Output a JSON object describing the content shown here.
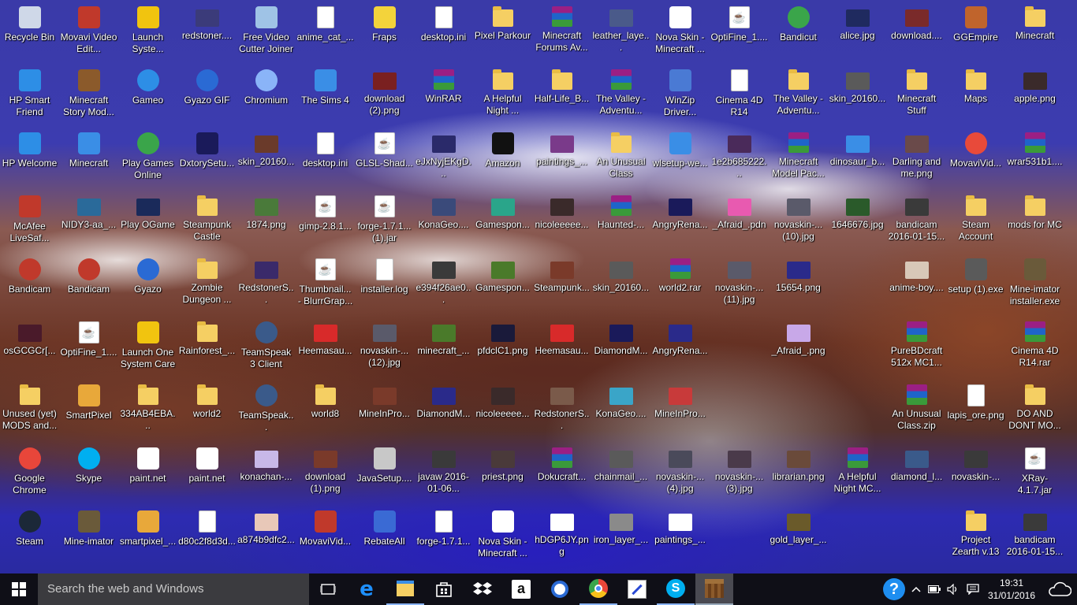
{
  "desktop": {
    "icons": [
      {
        "label": "Recycle Bin",
        "kind": "app",
        "color": "#cfd8e8"
      },
      {
        "label": "Movavi Video Edit...",
        "kind": "app",
        "color": "#c0392b"
      },
      {
        "label": "Launch Syste...",
        "kind": "app",
        "color": "#f1c40f"
      },
      {
        "label": "redstoner....",
        "kind": "img",
        "color": "#3b3b7a"
      },
      {
        "label": "Free Video Cutter Joiner",
        "kind": "app",
        "color": "#9fc3e6"
      },
      {
        "label": "anime_cat_...",
        "kind": "doc",
        "color": "#ffffff"
      },
      {
        "label": "Fraps",
        "kind": "app",
        "color": "#f3d33b"
      },
      {
        "label": "desktop.ini",
        "kind": "doc",
        "color": "#6a6fd1"
      },
      {
        "label": "Pixel Parkour",
        "kind": "folder",
        "color": "#f5cf63"
      },
      {
        "label": "Minecraft Forums Av...",
        "kind": "rar",
        "color": "#9b1f84"
      },
      {
        "label": "leather_laye...",
        "kind": "img",
        "color": "#4a5a8a"
      },
      {
        "label": "Nova Skin - Minecraft ...",
        "kind": "app",
        "color": "#ffffff"
      },
      {
        "label": "OptiFine_1....",
        "kind": "java",
        "color": "#ffffff"
      },
      {
        "label": "Bandicut",
        "kind": "round",
        "color": "#3aa54a"
      },
      {
        "label": "alice.jpg",
        "kind": "img",
        "color": "#1f2a5f"
      },
      {
        "label": "download....",
        "kind": "img",
        "color": "#7a2a2a"
      },
      {
        "label": "GGEmpire",
        "kind": "app",
        "color": "#c0642c"
      },
      {
        "label": "Minecraft",
        "kind": "folder",
        "color": "#f5cf63"
      },
      {
        "label": "HP Smart Friend",
        "kind": "app",
        "color": "#2d8ee6"
      },
      {
        "label": "Minecraft Story Mod...",
        "kind": "app",
        "color": "#8b5a2b"
      },
      {
        "label": "Gameo",
        "kind": "round",
        "color": "#2d8ee6"
      },
      {
        "label": "Gyazo GIF",
        "kind": "round",
        "color": "#2a6ad4"
      },
      {
        "label": "Chromium",
        "kind": "round",
        "color": "#8ab4f8"
      },
      {
        "label": "The Sims 4",
        "kind": "app",
        "color": "#3a8ee6"
      },
      {
        "label": "download (2).png",
        "kind": "img",
        "color": "#7a2020"
      },
      {
        "label": "WinRAR",
        "kind": "rar",
        "color": "#9b1f84"
      },
      {
        "label": "A Helpful Night ...",
        "kind": "folder",
        "color": "#f5cf63"
      },
      {
        "label": "Half-Life_B...",
        "kind": "folder",
        "color": "#f5cf63"
      },
      {
        "label": "The Valley -Adventu...",
        "kind": "rar",
        "color": "#9b1f84"
      },
      {
        "label": "WinZip Driver...",
        "kind": "app",
        "color": "#4a7ad4"
      },
      {
        "label": "Cinema 4D R14",
        "kind": "doc",
        "color": "#ffffff"
      },
      {
        "label": "The Valley -Adventu...",
        "kind": "folder",
        "color": "#f5cf63"
      },
      {
        "label": "skin_20160...",
        "kind": "img",
        "color": "#5a5a5a"
      },
      {
        "label": "Minecraft Stuff",
        "kind": "folder",
        "color": "#f5cf63"
      },
      {
        "label": "Maps",
        "kind": "folder",
        "color": "#f5cf63"
      },
      {
        "label": "apple.png",
        "kind": "img",
        "color": "#3a2a2a"
      },
      {
        "label": "HP Welcome",
        "kind": "app",
        "color": "#2d8ee6"
      },
      {
        "label": "Minecraft",
        "kind": "app",
        "color": "#3a8ee6"
      },
      {
        "label": "Play Games Online",
        "kind": "round",
        "color": "#3aa54a"
      },
      {
        "label": "DxtorySetu...",
        "kind": "app",
        "color": "#1a1a5a"
      },
      {
        "label": "skin_20160...",
        "kind": "img",
        "color": "#6a3a2a"
      },
      {
        "label": "desktop.ini",
        "kind": "doc",
        "color": "#6a6fd1"
      },
      {
        "label": "GLSL-Shad...",
        "kind": "java",
        "color": "#ffffff"
      },
      {
        "label": "eJxNyjEKgD...",
        "kind": "img",
        "color": "#2a2a6a"
      },
      {
        "label": "Amazon",
        "kind": "app",
        "color": "#111111"
      },
      {
        "label": "paintings_...",
        "kind": "img",
        "color": "#7a3a8a"
      },
      {
        "label": "An Unusual Class",
        "kind": "folder",
        "color": "#f5cf63"
      },
      {
        "label": "wlsetup-we...",
        "kind": "app",
        "color": "#3a8ee6"
      },
      {
        "label": "1e2b685222...",
        "kind": "img",
        "color": "#4a2a5a"
      },
      {
        "label": "Minecraft Model Pac...",
        "kind": "rar",
        "color": "#9b1f84"
      },
      {
        "label": "dinosaur_b...",
        "kind": "img",
        "color": "#3a8ee6"
      },
      {
        "label": "Darling and me.png",
        "kind": "img",
        "color": "#6a4a4a"
      },
      {
        "label": "MovaviVid...",
        "kind": "round",
        "color": "#e84a3a"
      },
      {
        "label": "wrar531b1....",
        "kind": "rar",
        "color": "#9b1f84"
      },
      {
        "label": "McAfee LiveSaf...",
        "kind": "app",
        "color": "#c0392b"
      },
      {
        "label": "NIDY3-aa_...",
        "kind": "img",
        "color": "#2a6a9a"
      },
      {
        "label": "Play OGame",
        "kind": "img",
        "color": "#1a2a5a"
      },
      {
        "label": "Steampunk Castle",
        "kind": "folder",
        "color": "#f5cf63"
      },
      {
        "label": "1874.png",
        "kind": "img",
        "color": "#4a7a3a"
      },
      {
        "label": "gimp-2.8.1...",
        "kind": "java",
        "color": "#ffffff"
      },
      {
        "label": "forge-1.7.1... (1).jar",
        "kind": "java",
        "color": "#ffffff"
      },
      {
        "label": "KonaGeo....",
        "kind": "img",
        "color": "#3a4a7a"
      },
      {
        "label": "Gamespon...",
        "kind": "img",
        "color": "#2aa58a"
      },
      {
        "label": "nicoleeeee...",
        "kind": "img",
        "color": "#3a2a2a"
      },
      {
        "label": "Haunted-...",
        "kind": "rar",
        "color": "#9b1f84"
      },
      {
        "label": "AngryRena...",
        "kind": "img",
        "color": "#1a1a5a"
      },
      {
        "label": "_Afraid_.pdn",
        "kind": "img",
        "color": "#e85ab0"
      },
      {
        "label": "novaskin-... (10).jpg",
        "kind": "img",
        "color": "#5a5a6a"
      },
      {
        "label": "1646676.jpg",
        "kind": "img",
        "color": "#2a5a2a"
      },
      {
        "label": "bandicam 2016-01-15...",
        "kind": "img",
        "color": "#3a3a3a"
      },
      {
        "label": "Steam Account",
        "kind": "folder",
        "color": "#f5cf63"
      },
      {
        "label": "mods for MC",
        "kind": "folder",
        "color": "#f5cf63"
      },
      {
        "label": "Bandicam",
        "kind": "round",
        "color": "#c0392b"
      },
      {
        "label": "Bandicam",
        "kind": "round",
        "color": "#c0392b"
      },
      {
        "label": "Gyazo",
        "kind": "round",
        "color": "#2a6ad4"
      },
      {
        "label": "Zombie Dungeon ...",
        "kind": "folder",
        "color": "#f5cf63"
      },
      {
        "label": "RedstonerS...",
        "kind": "img",
        "color": "#3a2a6a"
      },
      {
        "label": "Thumbnail... - BlurrGrap...",
        "kind": "java",
        "color": "#ffffff"
      },
      {
        "label": "installer.log",
        "kind": "doc",
        "color": "#ffffff"
      },
      {
        "label": "e394f26ae0...",
        "kind": "img",
        "color": "#3a3a3a"
      },
      {
        "label": "Gamespon...",
        "kind": "img",
        "color": "#4a7a2a"
      },
      {
        "label": "Steampunk...",
        "kind": "img",
        "color": "#7a3a2a"
      },
      {
        "label": "skin_20160...",
        "kind": "img",
        "color": "#5a5a5a"
      },
      {
        "label": "world2.rar",
        "kind": "rar",
        "color": "#9b1f84"
      },
      {
        "label": "novaskin-... (11).jpg",
        "kind": "img",
        "color": "#5a5a6a"
      },
      {
        "label": "15654.png",
        "kind": "img",
        "color": "#2a2a8a"
      },
      {
        "label": "anime-boy....",
        "kind": "img",
        "color": "#d8c8b8"
      },
      {
        "label": "setup (1).exe",
        "kind": "app",
        "color": "#5a5a5a"
      },
      {
        "label": "Mine-imator installer.exe",
        "kind": "app",
        "color": "#6a5a3a"
      },
      {
        "label": "osGCGCr[...",
        "kind": "img",
        "color": "#4a1a2a"
      },
      {
        "label": "OptiFine_1....",
        "kind": "java",
        "color": "#ffffff"
      },
      {
        "label": "Launch One System Care",
        "kind": "app",
        "color": "#f1c40f"
      },
      {
        "label": "Rainforest_...",
        "kind": "folder",
        "color": "#f5cf63"
      },
      {
        "label": "TeamSpeak 3 Client",
        "kind": "round",
        "color": "#3a5a8a"
      },
      {
        "label": "Heemasau...",
        "kind": "img",
        "color": "#d82a2a"
      },
      {
        "label": "novaskin-... (12).jpg",
        "kind": "img",
        "color": "#5a5a6a"
      },
      {
        "label": "minecraft_...",
        "kind": "img",
        "color": "#4a7a2a"
      },
      {
        "label": "pfdclC1.png",
        "kind": "img",
        "color": "#1a1a3a"
      },
      {
        "label": "Heemasau...",
        "kind": "img",
        "color": "#d82a2a"
      },
      {
        "label": "DiamondM...",
        "kind": "img",
        "color": "#1a1a5a"
      },
      {
        "label": "AngryRena...",
        "kind": "img",
        "color": "#2a2a8a"
      },
      {
        "label": "_Afraid_.png",
        "kind": "img",
        "color": "#c8a8e8"
      },
      {
        "label": "PureBDcraft 512x MC1...",
        "kind": "rar",
        "color": "#9b1f84"
      },
      {
        "label": "Cinema 4D R14.rar",
        "kind": "rar",
        "color": "#9b1f84"
      },
      {
        "label": "Unused (yet) MODS and...",
        "kind": "folder",
        "color": "#f5cf63"
      },
      {
        "label": "SmartPixel",
        "kind": "app",
        "color": "#e8a83a"
      },
      {
        "label": "334AB4EBA...",
        "kind": "folder",
        "color": "#f5cf63"
      },
      {
        "label": "world2",
        "kind": "folder",
        "color": "#f5cf63"
      },
      {
        "label": "TeamSpeak...",
        "kind": "round",
        "color": "#3a5a8a"
      },
      {
        "label": "world8",
        "kind": "folder",
        "color": "#f5cf63"
      },
      {
        "label": "MineInPro...",
        "kind": "img",
        "color": "#7a3a2a"
      },
      {
        "label": "DiamondM...",
        "kind": "img",
        "color": "#2a2a8a"
      },
      {
        "label": "nicoleeeee...",
        "kind": "img",
        "color": "#3a2a2a"
      },
      {
        "label": "RedstonerS...",
        "kind": "img",
        "color": "#7a5a4a"
      },
      {
        "label": "KonaGeo....",
        "kind": "img",
        "color": "#3aa5c8"
      },
      {
        "label": "MineInPro...",
        "kind": "img",
        "color": "#c83a3a"
      },
      {
        "label": "An Unusual Class.zip",
        "kind": "rar",
        "color": "#9b1f84"
      },
      {
        "label": "lapis_ore.png",
        "kind": "doc",
        "color": "#ffffff"
      },
      {
        "label": "DO AND DONT MO...",
        "kind": "folder",
        "color": "#f5cf63"
      },
      {
        "label": "Google Chrome",
        "kind": "round",
        "color": "#e8463a"
      },
      {
        "label": "Skype",
        "kind": "round",
        "color": "#00aff0"
      },
      {
        "label": "paint.net",
        "kind": "app",
        "color": "#ffffff"
      },
      {
        "label": "paint.net",
        "kind": "app",
        "color": "#ffffff"
      },
      {
        "label": "konachan-...",
        "kind": "img",
        "color": "#c8b8e8"
      },
      {
        "label": "download (1).png",
        "kind": "img",
        "color": "#7a3a2a"
      },
      {
        "label": "JavaSetup....",
        "kind": "app",
        "color": "#c8c8c8"
      },
      {
        "label": "javaw 2016-01-06...",
        "kind": "img",
        "color": "#3a3a3a"
      },
      {
        "label": "priest.png",
        "kind": "img",
        "color": "#4a3a3a"
      },
      {
        "label": "Dokucraft...",
        "kind": "rar",
        "color": "#9b1f84"
      },
      {
        "label": "chainmail_...",
        "kind": "img",
        "color": "#5a5a5a"
      },
      {
        "label": "novaskin-... (4).jpg",
        "kind": "img",
        "color": "#4a4a5a"
      },
      {
        "label": "novaskin-... (3).jpg",
        "kind": "img",
        "color": "#4a3a4a"
      },
      {
        "label": "librarian.png",
        "kind": "img",
        "color": "#6a4a3a"
      },
      {
        "label": "A Helpful Night MC...",
        "kind": "rar",
        "color": "#9b1f84"
      },
      {
        "label": "diamond_l...",
        "kind": "img",
        "color": "#3a5a8a"
      },
      {
        "label": "novaskin-...",
        "kind": "img",
        "color": "#3a3a3a"
      },
      {
        "label": "XRay-4.1.7.jar",
        "kind": "java",
        "color": "#ffffff"
      },
      {
        "label": "Steam",
        "kind": "round",
        "color": "#1b2838"
      },
      {
        "label": "Mine-imator",
        "kind": "app",
        "color": "#6a5a3a"
      },
      {
        "label": "smartpixel_...",
        "kind": "app",
        "color": "#e8a83a"
      },
      {
        "label": "d80c2f8d3d...",
        "kind": "doc",
        "color": "#ffffff"
      },
      {
        "label": "a874b9dfc2...",
        "kind": "img",
        "color": "#e8c8b8"
      },
      {
        "label": "MovaviVid...",
        "kind": "app",
        "color": "#c0392b"
      },
      {
        "label": "RebateAll",
        "kind": "app",
        "color": "#3a6ad4"
      },
      {
        "label": "forge-1.7.1...",
        "kind": "doc",
        "color": "#ffffff"
      },
      {
        "label": "Nova Skin - Minecraft ...",
        "kind": "app",
        "color": "#ffffff"
      },
      {
        "label": "hDGP6JY.png",
        "kind": "img",
        "color": "#ffffff"
      },
      {
        "label": "iron_layer_...",
        "kind": "img",
        "color": "#8a8a8a"
      },
      {
        "label": "paintings_...",
        "kind": "img",
        "color": "#ffffff"
      },
      {
        "label": "gold_layer_...",
        "kind": "img",
        "color": "#6a5a2a"
      },
      {
        "label": "Project Zearth v.13",
        "kind": "folder",
        "color": "#f5cf63"
      },
      {
        "label": "bandicam 2016-01-15...",
        "kind": "img",
        "color": "#3a3a3a"
      }
    ]
  },
  "taskbar": {
    "search_placeholder": "Search the web and Windows",
    "pinned": [
      {
        "name": "task-view",
        "icon": "task-view-icon"
      },
      {
        "name": "edge",
        "icon": "edge-icon"
      },
      {
        "name": "file-explorer",
        "icon": "folder-icon"
      },
      {
        "name": "store",
        "icon": "store-icon"
      },
      {
        "name": "dropbox",
        "icon": "dropbox-icon"
      },
      {
        "name": "amazon",
        "icon": "amazon-icon"
      },
      {
        "name": "gyazo",
        "icon": "gyazo-icon"
      },
      {
        "name": "chrome",
        "icon": "chrome-icon"
      },
      {
        "name": "paint-net",
        "icon": "paint-icon"
      },
      {
        "name": "skype",
        "icon": "skype-icon"
      },
      {
        "name": "minecraft",
        "icon": "crafting-table-icon"
      }
    ],
    "tray": {
      "help_icon": "question-icon",
      "time": "19:31",
      "date": "31/01/2016"
    }
  }
}
